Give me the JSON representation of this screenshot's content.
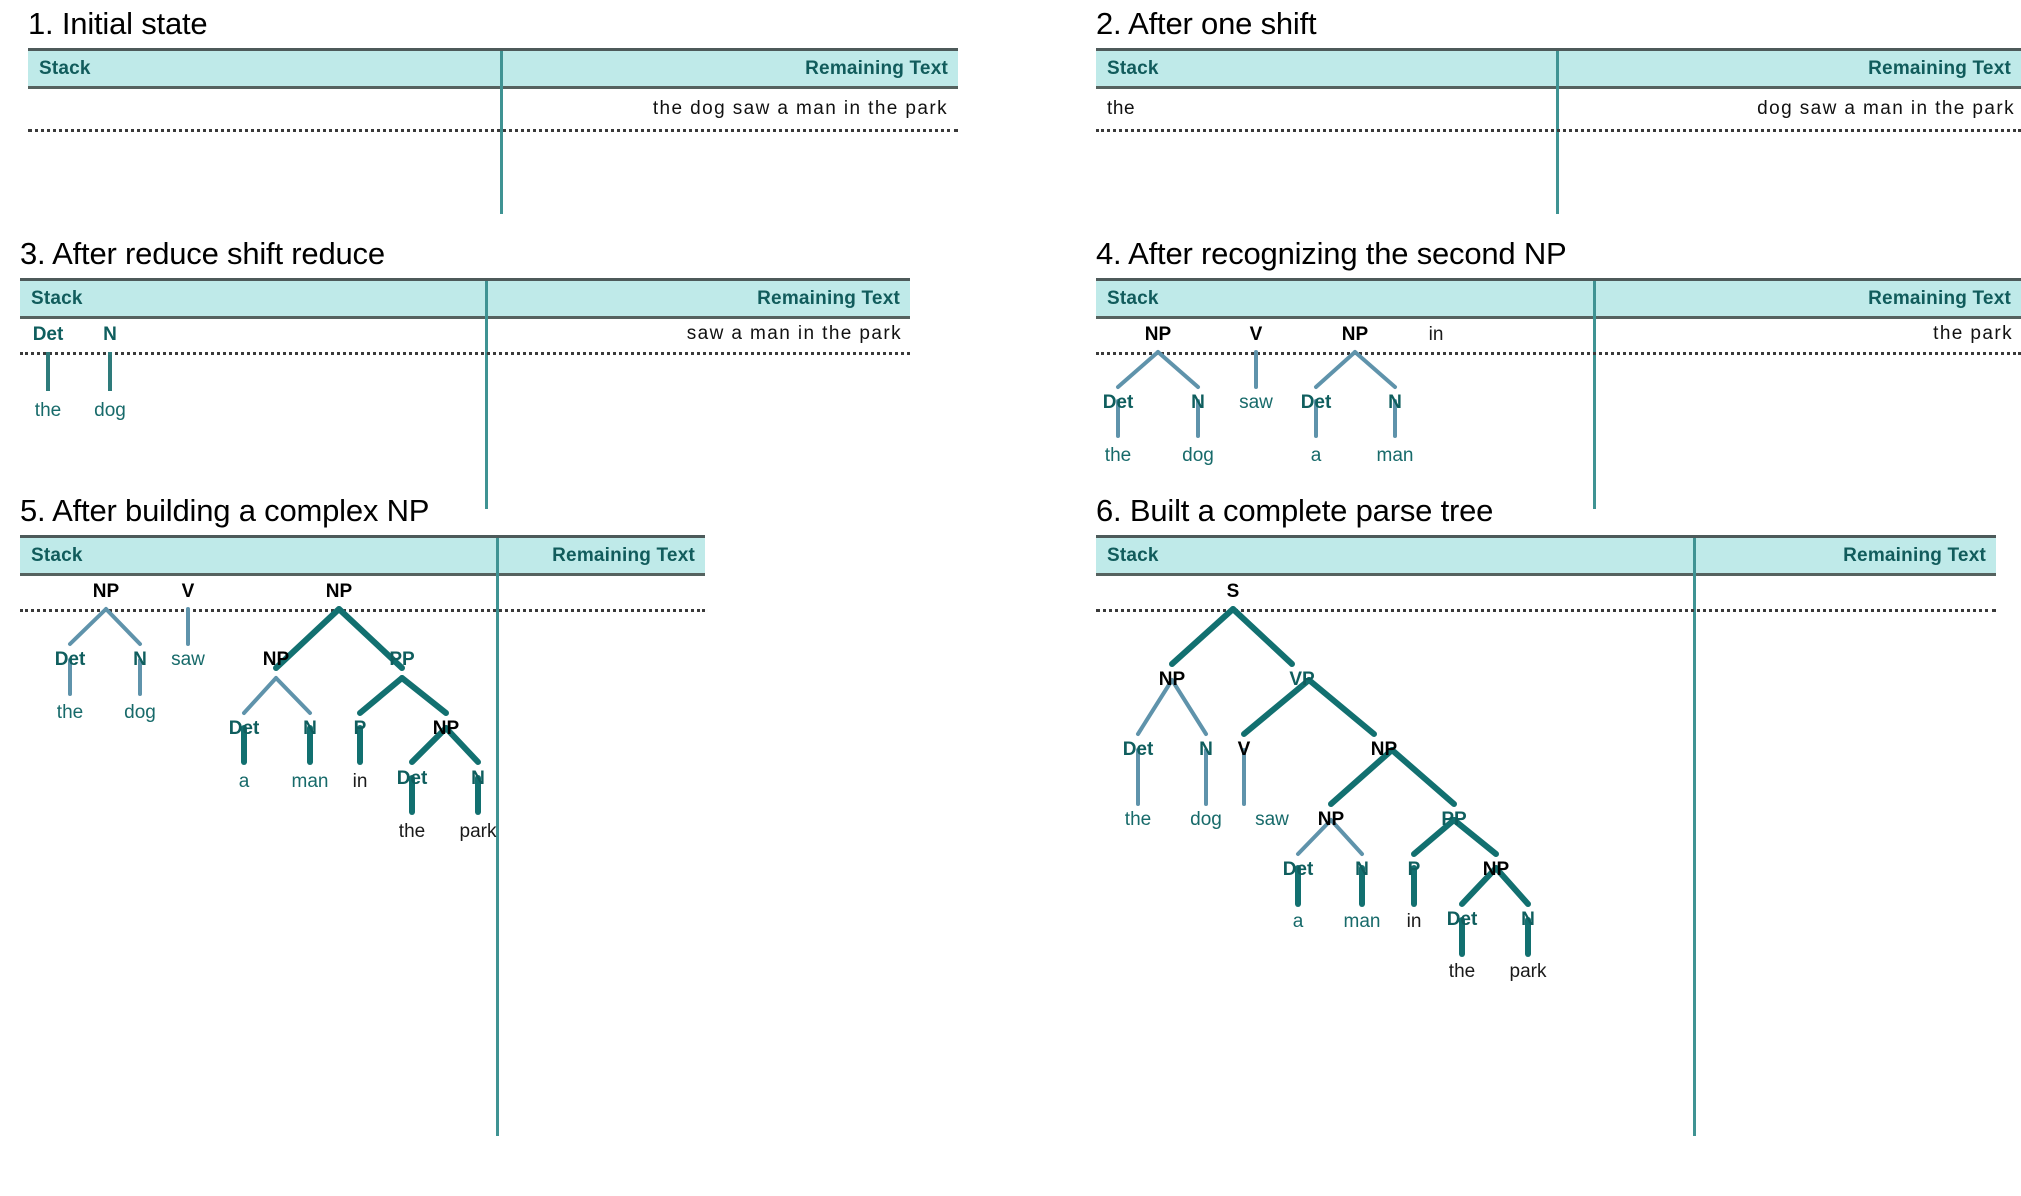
{
  "colors": {
    "header_bg": "#bfeae9",
    "header_text": "#115c5c",
    "divider": "#3f9393",
    "branch_dark": "#127070",
    "branch_light": "#5f93ab",
    "rule": "#4d5a5a"
  },
  "columns": {
    "stack": "Stack",
    "remaining": "Remaining Text"
  },
  "panels": [
    {
      "id": "p1",
      "title": "1. Initial state",
      "stack_text": "",
      "remaining_text": "the dog saw a man in the park"
    },
    {
      "id": "p2",
      "title": "2. After one shift",
      "stack_text": "the",
      "remaining_text": "dog saw a man in the park"
    },
    {
      "id": "p3",
      "title": "3. After reduce shift reduce",
      "stack_text": "",
      "remaining_text": "saw a man in the park",
      "nodes": [
        {
          "label": "Det",
          "kind": "pos"
        },
        {
          "label": "N",
          "kind": "pos"
        },
        {
          "label": "the",
          "kind": "leaf-t"
        },
        {
          "label": "dog",
          "kind": "leaf-t"
        }
      ]
    },
    {
      "id": "p4",
      "title": "4. After recognizing the second NP",
      "stack_text": "",
      "remaining_text": "the park",
      "nodes": [
        {
          "label": "NP",
          "kind": "nt"
        },
        {
          "label": "V",
          "kind": "nt"
        },
        {
          "label": "NP",
          "kind": "nt"
        },
        {
          "label": "in",
          "kind": "leaf"
        },
        {
          "label": "Det",
          "kind": "pos"
        },
        {
          "label": "N",
          "kind": "pos"
        },
        {
          "label": "saw",
          "kind": "leaf-t"
        },
        {
          "label": "Det",
          "kind": "pos"
        },
        {
          "label": "N",
          "kind": "pos"
        },
        {
          "label": "the",
          "kind": "leaf-t"
        },
        {
          "label": "dog",
          "kind": "leaf-t"
        },
        {
          "label": "a",
          "kind": "leaf-t"
        },
        {
          "label": "man",
          "kind": "leaf-t"
        }
      ]
    },
    {
      "id": "p5",
      "title": "5. After building a complex NP",
      "stack_text": "",
      "remaining_text": "",
      "nodes": [
        {
          "label": "NP",
          "kind": "nt"
        },
        {
          "label": "V",
          "kind": "nt"
        },
        {
          "label": "NP",
          "kind": "nt"
        },
        {
          "label": "Det",
          "kind": "pos"
        },
        {
          "label": "N",
          "kind": "pos"
        },
        {
          "label": "saw",
          "kind": "leaf-t"
        },
        {
          "label": "NP",
          "kind": "nt"
        },
        {
          "label": "PP",
          "kind": "pos"
        },
        {
          "label": "the",
          "kind": "leaf-t"
        },
        {
          "label": "dog",
          "kind": "leaf-t"
        },
        {
          "label": "Det",
          "kind": "pos"
        },
        {
          "label": "N",
          "kind": "pos"
        },
        {
          "label": "P",
          "kind": "pos"
        },
        {
          "label": "NP",
          "kind": "nt"
        },
        {
          "label": "a",
          "kind": "leaf-t"
        },
        {
          "label": "man",
          "kind": "leaf-t"
        },
        {
          "label": "in",
          "kind": "leaf"
        },
        {
          "label": "Det",
          "kind": "pos"
        },
        {
          "label": "N",
          "kind": "pos"
        },
        {
          "label": "the",
          "kind": "leaf"
        },
        {
          "label": "park",
          "kind": "leaf"
        }
      ]
    },
    {
      "id": "p6",
      "title": "6. Built a complete parse tree",
      "stack_text": "",
      "remaining_text": "",
      "nodes": [
        {
          "label": "S",
          "kind": "nt"
        },
        {
          "label": "NP",
          "kind": "nt"
        },
        {
          "label": "VP",
          "kind": "pos"
        },
        {
          "label": "Det",
          "kind": "pos"
        },
        {
          "label": "N",
          "kind": "pos"
        },
        {
          "label": "V",
          "kind": "nt"
        },
        {
          "label": "NP",
          "kind": "nt"
        },
        {
          "label": "the",
          "kind": "leaf-t"
        },
        {
          "label": "dog",
          "kind": "leaf-t"
        },
        {
          "label": "saw",
          "kind": "leaf-t"
        },
        {
          "label": "NP",
          "kind": "nt"
        },
        {
          "label": "PP",
          "kind": "pos"
        },
        {
          "label": "Det",
          "kind": "pos"
        },
        {
          "label": "N",
          "kind": "pos"
        },
        {
          "label": "P",
          "kind": "pos"
        },
        {
          "label": "NP",
          "kind": "nt"
        },
        {
          "label": "a",
          "kind": "leaf-t"
        },
        {
          "label": "man",
          "kind": "leaf-t"
        },
        {
          "label": "in",
          "kind": "leaf"
        },
        {
          "label": "Det",
          "kind": "pos"
        },
        {
          "label": "N",
          "kind": "pos"
        },
        {
          "label": "the",
          "kind": "leaf"
        },
        {
          "label": "park",
          "kind": "leaf"
        }
      ]
    }
  ],
  "parse_trees": {
    "final": "(S (NP (Det the) (N dog)) (VP (V saw) (NP (NP (Det a) (N man)) (PP (P in) (NP (Det the) (N park))))))",
    "sentence": "the dog saw a man in the park"
  }
}
